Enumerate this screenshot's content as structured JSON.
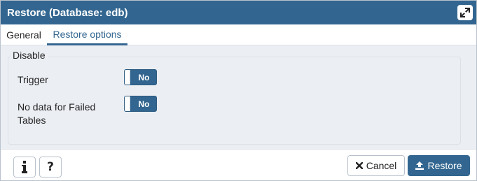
{
  "dialog": {
    "title": "Restore (Database: edb)",
    "maximize_icon": "expand-icon"
  },
  "tabs": [
    {
      "label": "General",
      "active": false
    },
    {
      "label": "Restore options",
      "active": true
    }
  ],
  "disable": {
    "legend": "Disable",
    "rows": [
      {
        "label_lines": [
          "Trigger"
        ],
        "toggle_value": "No"
      },
      {
        "label_lines": [
          "No data for Failed",
          "Tables"
        ],
        "toggle_value": "No"
      }
    ]
  },
  "footer": {
    "info_icon": "info-icon",
    "help_icon": "question-icon",
    "cancel_label": "Cancel",
    "cancel_icon": "close-icon",
    "restore_label": "Restore",
    "restore_icon": "upload-icon"
  },
  "colors": {
    "accent": "#326690",
    "panel_bg": "#ebeef3",
    "border": "#dde0e6"
  }
}
